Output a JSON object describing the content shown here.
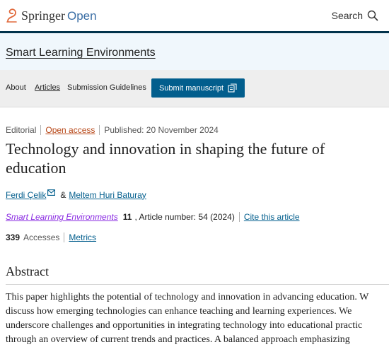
{
  "header": {
    "brand_name": "Springer",
    "brand_suffix": "Open",
    "search_label": "Search"
  },
  "journal": {
    "title": "Smart Learning Environments"
  },
  "nav": {
    "about": "About",
    "articles": "Articles",
    "guidelines": "Submission Guidelines",
    "submit": "Submit manuscript"
  },
  "article": {
    "type": "Editorial",
    "access": "Open access",
    "published": "Published: 20 November 2024",
    "title": "Technology and innovation in shaping the future of education",
    "authors": [
      {
        "name": "Ferdi Çelik"
      },
      {
        "name": "Meltem Huri Baturay"
      }
    ],
    "author_joiner": "&",
    "journal_name": "Smart Learning Environments",
    "volume": "11",
    "article_number": ", Article number: 54 (2024)",
    "cite_label": "Cite this article",
    "accesses_count": "339",
    "accesses_label": "Accesses",
    "metrics_label": "Metrics"
  },
  "abstract": {
    "heading": "Abstract",
    "lines": [
      "This paper highlights the potential of technology and innovation in advancing education. W",
      "discuss how emerging technologies can enhance teaching and learning experiences. We",
      "underscore challenges and opportunities in integrating technology into educational practic",
      "through an overview of current trends and practices. A balanced approach emphasizing"
    ]
  },
  "colors": {
    "link": "#025e8d",
    "open_access": "#b74616",
    "header_rule": "#01324b",
    "journal_band": "#f0f7fc",
    "nav_band": "#eeeeee"
  },
  "icons": [
    "springer-logo-icon",
    "search-icon",
    "external-submit-icon",
    "mail-icon"
  ]
}
